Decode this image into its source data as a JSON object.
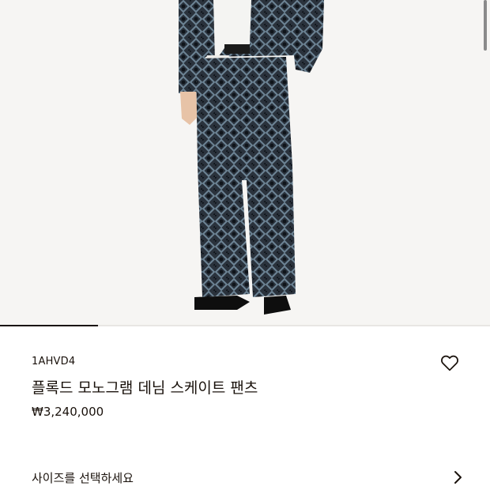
{
  "product": {
    "sku": "1AHVD4",
    "name": "플록드 모노그램 데님 스케이트 팬츠",
    "price": "₩3,240,000"
  },
  "gallery": {
    "progress_fraction": 0.2
  },
  "size_selector": {
    "label": "사이즈를 선택하세요"
  },
  "icons": {
    "wishlist": "heart-icon",
    "size_selector": "chevron-right-icon"
  },
  "colors": {
    "text": "#19110b",
    "hero_background": "#f6f5f3"
  }
}
